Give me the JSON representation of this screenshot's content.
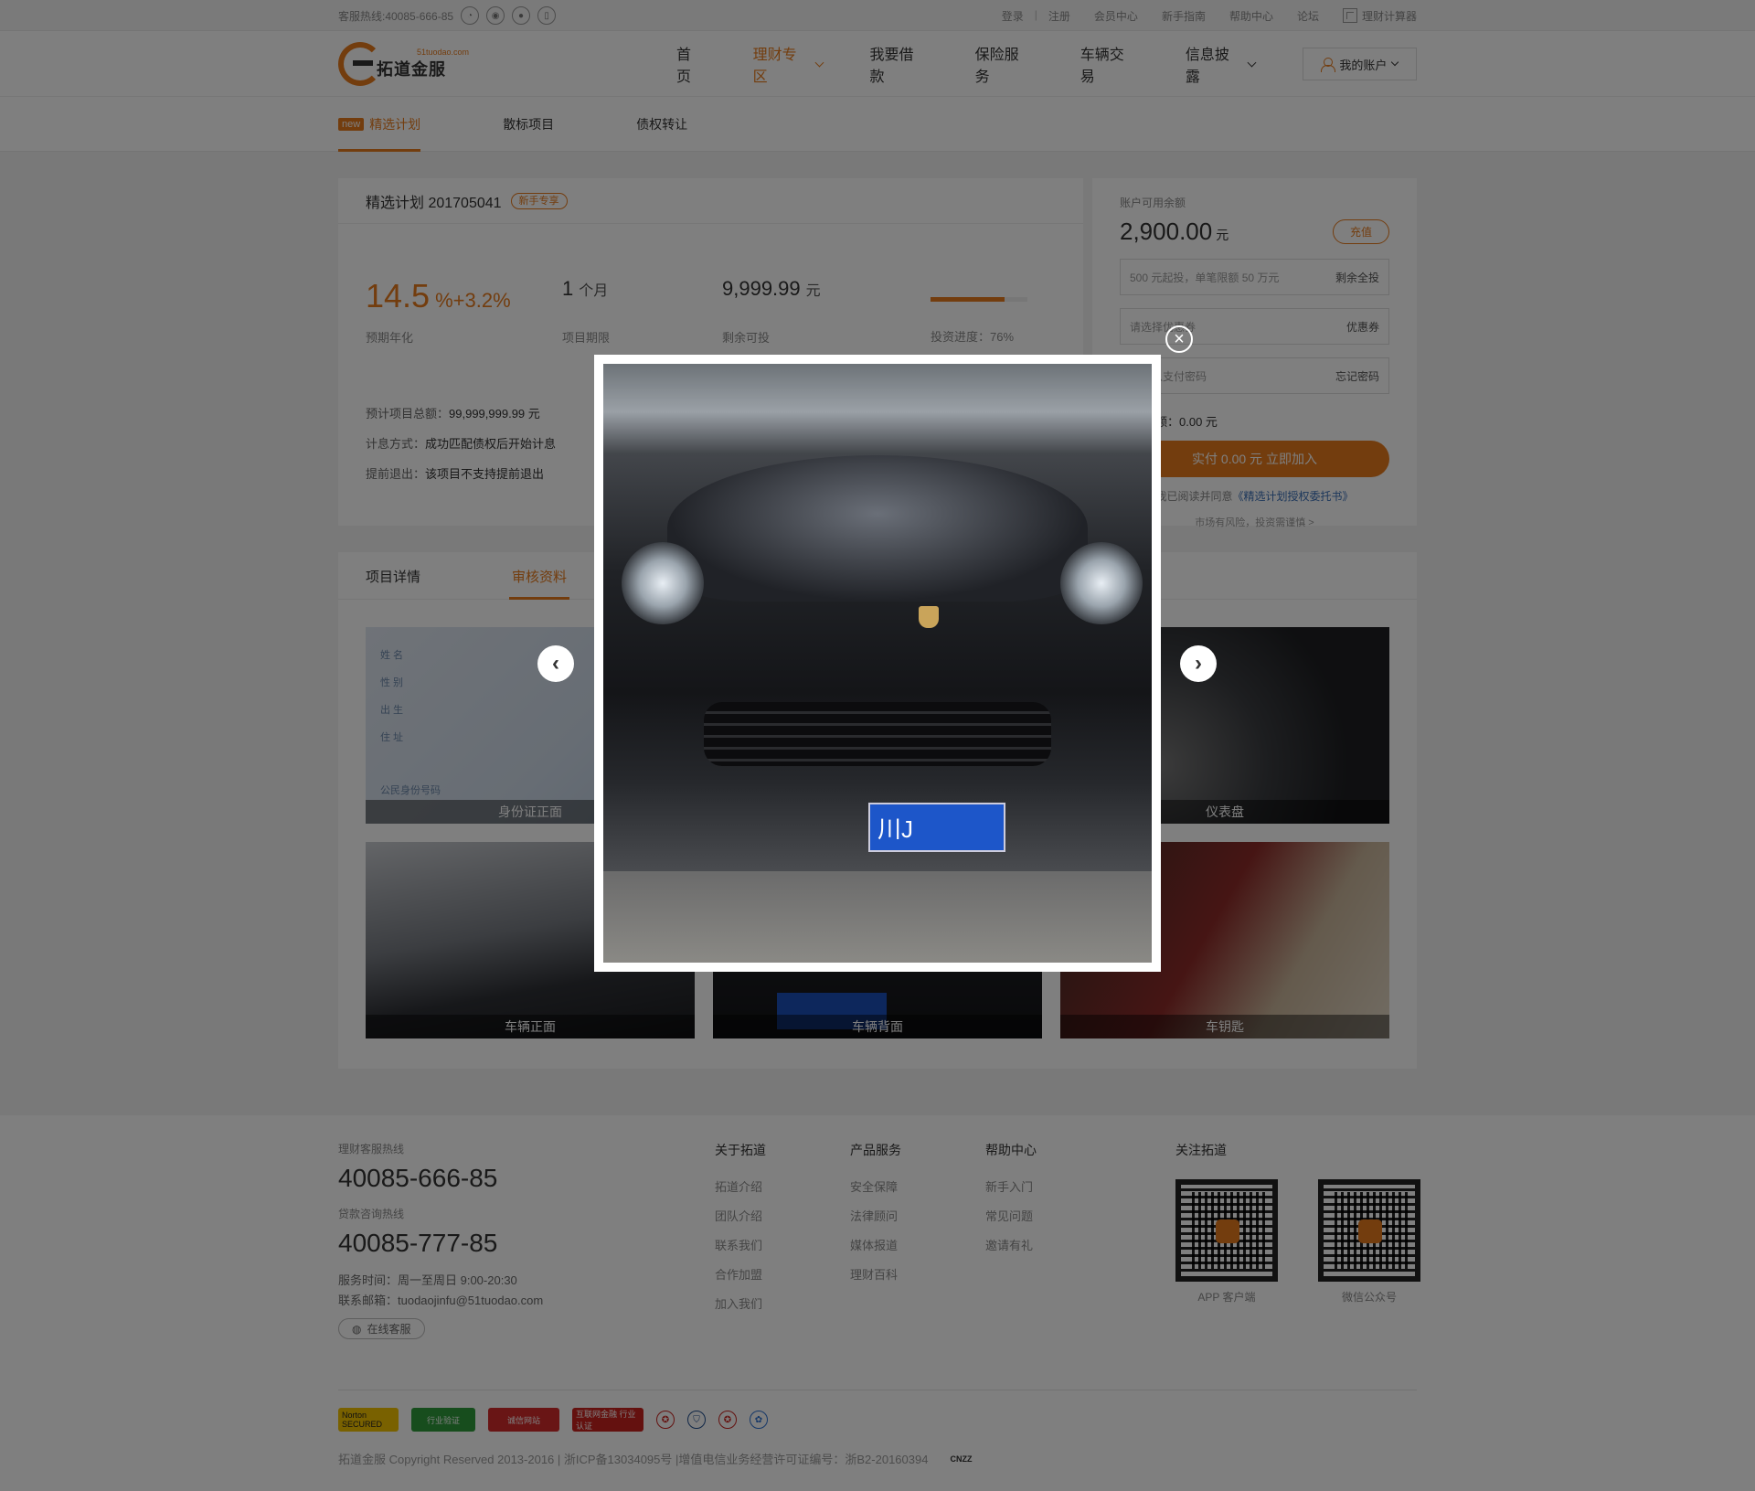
{
  "topbar": {
    "hotline": "客服热线:40085-666-85",
    "links": [
      "登录",
      "注册",
      "会员中心",
      "新手指南",
      "帮助中心",
      "论坛"
    ],
    "separator": "|",
    "calculator": "理财计算器"
  },
  "header": {
    "logo_small": "51tuodao.com",
    "logo_cn": "拓道金服",
    "nav": [
      {
        "label": "首页",
        "active": false
      },
      {
        "label": "理财专区",
        "active": true
      },
      {
        "label": "我要借款",
        "active": false
      },
      {
        "label": "保险服务",
        "active": false
      },
      {
        "label": "车辆交易",
        "active": false
      },
      {
        "label": "信息披露",
        "active": false
      }
    ],
    "account": "我的账户"
  },
  "subnav": {
    "new_tag": "new",
    "tabs": [
      "精选计划",
      "散标项目",
      "债权转让"
    ]
  },
  "product": {
    "title": "精选计划 201705041",
    "tag": "新手专享",
    "rate": "14.5",
    "rate_extra": "%+3.2%",
    "rate_label": "预期年化",
    "term_num": "1",
    "term_unit": "个月",
    "term_label": "项目期限",
    "remaining": "9,999.99",
    "remaining_unit": "元",
    "remaining_label": "剩余可投",
    "progress_label": "投资进度：76%",
    "progress_value": 0.76,
    "info": [
      {
        "label": "预计项目总额：",
        "value": "99,999,999.99 元"
      },
      {
        "label": "计息方式：",
        "value": "成功匹配债权后开始计息"
      },
      {
        "label": "提前退出：",
        "value": "该项目不支持提前退出"
      }
    ]
  },
  "invest": {
    "balance_label": "账户可用余额",
    "balance": "2,900.00",
    "balance_unit": "元",
    "recharge": "充值",
    "amount_placeholder": "500 元起投，单笔限额 50 万元",
    "amount_action": "剩余全投",
    "coupon_placeholder": "请选择优惠券",
    "coupon_action": "优惠券",
    "password_placeholder": "请输入支付密码",
    "password_action": "忘记密码",
    "pay_text": "实付金额：0.00 元",
    "join_button": "实付 0.00 元  立即加入",
    "agree_text": "我已阅读并同意",
    "agree_link": "《精选计划授权委托书》",
    "risk": "市场有风险，投资需谨慎 >"
  },
  "details": {
    "tabs": [
      {
        "label": "项目详情",
        "active": false
      },
      {
        "label": "审核资料",
        "active": true
      }
    ],
    "id_lines": [
      "姓 名",
      "性 别",
      "出 生",
      "住 址",
      "公民身份号码"
    ],
    "photos": [
      {
        "caption": "身份证正面"
      },
      {
        "caption": ""
      },
      {
        "caption": "仪表盘"
      },
      {
        "caption": "车辆正面"
      },
      {
        "caption": "车辆背面"
      },
      {
        "caption": "车钥匙"
      }
    ]
  },
  "modal": {
    "close": "×",
    "prev": "‹",
    "next": "›",
    "plate_text": "川J"
  },
  "footer": {
    "hotline_label": "理财客服热线",
    "hotline": "40085-666-85",
    "loan_label": "贷款咨询热线",
    "loan_hotline": "40085-777-85",
    "service_time": "服务时间：周一至周日  9:00-20:30",
    "email": "联系邮箱：tuodaojinfu@51tuodao.com",
    "online_service": "在线客服",
    "columns": [
      {
        "title": "关于拓道",
        "items": [
          "拓道介绍",
          "团队介绍",
          "联系我们",
          "合作加盟",
          "加入我们"
        ]
      },
      {
        "title": "产品服务",
        "items": [
          "安全保障",
          "法律顾问",
          "媒体报道",
          "理财百科"
        ]
      },
      {
        "title": "帮助中心",
        "items": [
          "新手入门",
          "常见问题",
          "邀请有礼"
        ]
      }
    ],
    "follow_title": "关注拓道",
    "qr_labels": [
      "APP 客户端",
      "微信公众号"
    ],
    "badges": [
      "Norton SECURED",
      "行业验证",
      "诚信网站",
      "互联网金融 行业认证"
    ],
    "copyright": "拓道金服 Copyright Reserved 2013-2016 | 浙ICP备13034095号 |增值电信业务经营许可证编号：浙B2-20160394",
    "cnzz": "CNZZ"
  },
  "colors": {
    "accent": "#e67a1d",
    "link": "#3a6fb7"
  }
}
